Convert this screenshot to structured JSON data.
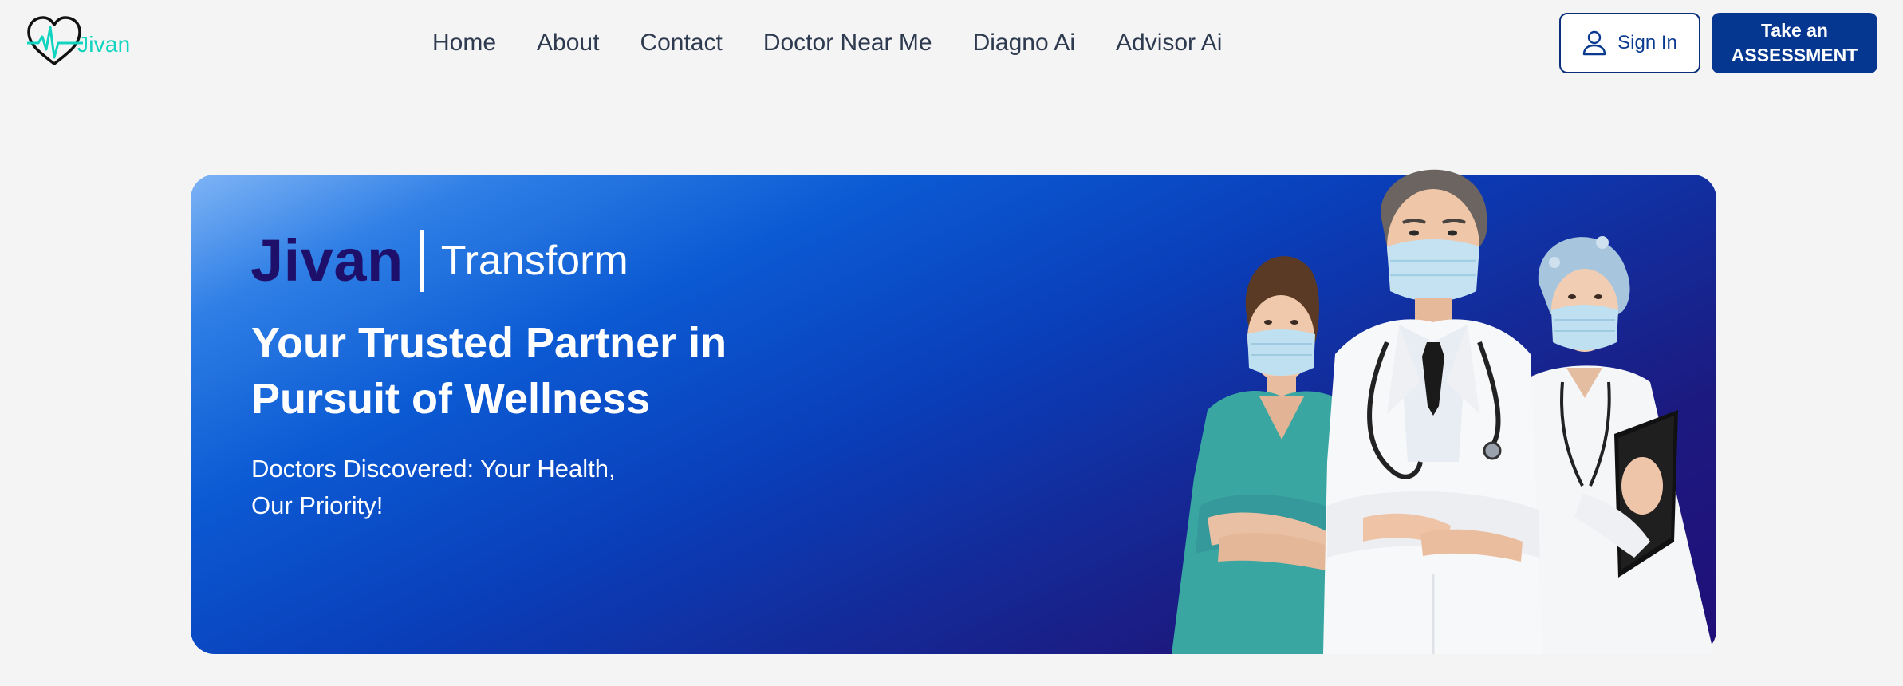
{
  "header": {
    "logo_text": "Jivan",
    "nav": [
      "Home",
      "About",
      "Contact",
      "Doctor Near Me",
      "Diagno Ai",
      "Advisor Ai"
    ],
    "signin_label": "Sign In",
    "assessment_label_line1": "Take an",
    "assessment_label_line2": "ASSESSMENT"
  },
  "hero": {
    "brand": "Jivan",
    "brand_sub": "Transform",
    "title_line1": "Your Trusted Partner in",
    "title_line2": "Pursuit of Wellness",
    "subtitle_line1": "Doctors Discovered: Your Health,",
    "subtitle_line2": "Our Priority!"
  },
  "colors": {
    "accent_teal": "#10d4bf",
    "primary_navy": "#063790",
    "brand_purple": "#1e0f6b"
  },
  "icons": {
    "logo": "heart-pulse-icon",
    "signin": "user-icon"
  }
}
